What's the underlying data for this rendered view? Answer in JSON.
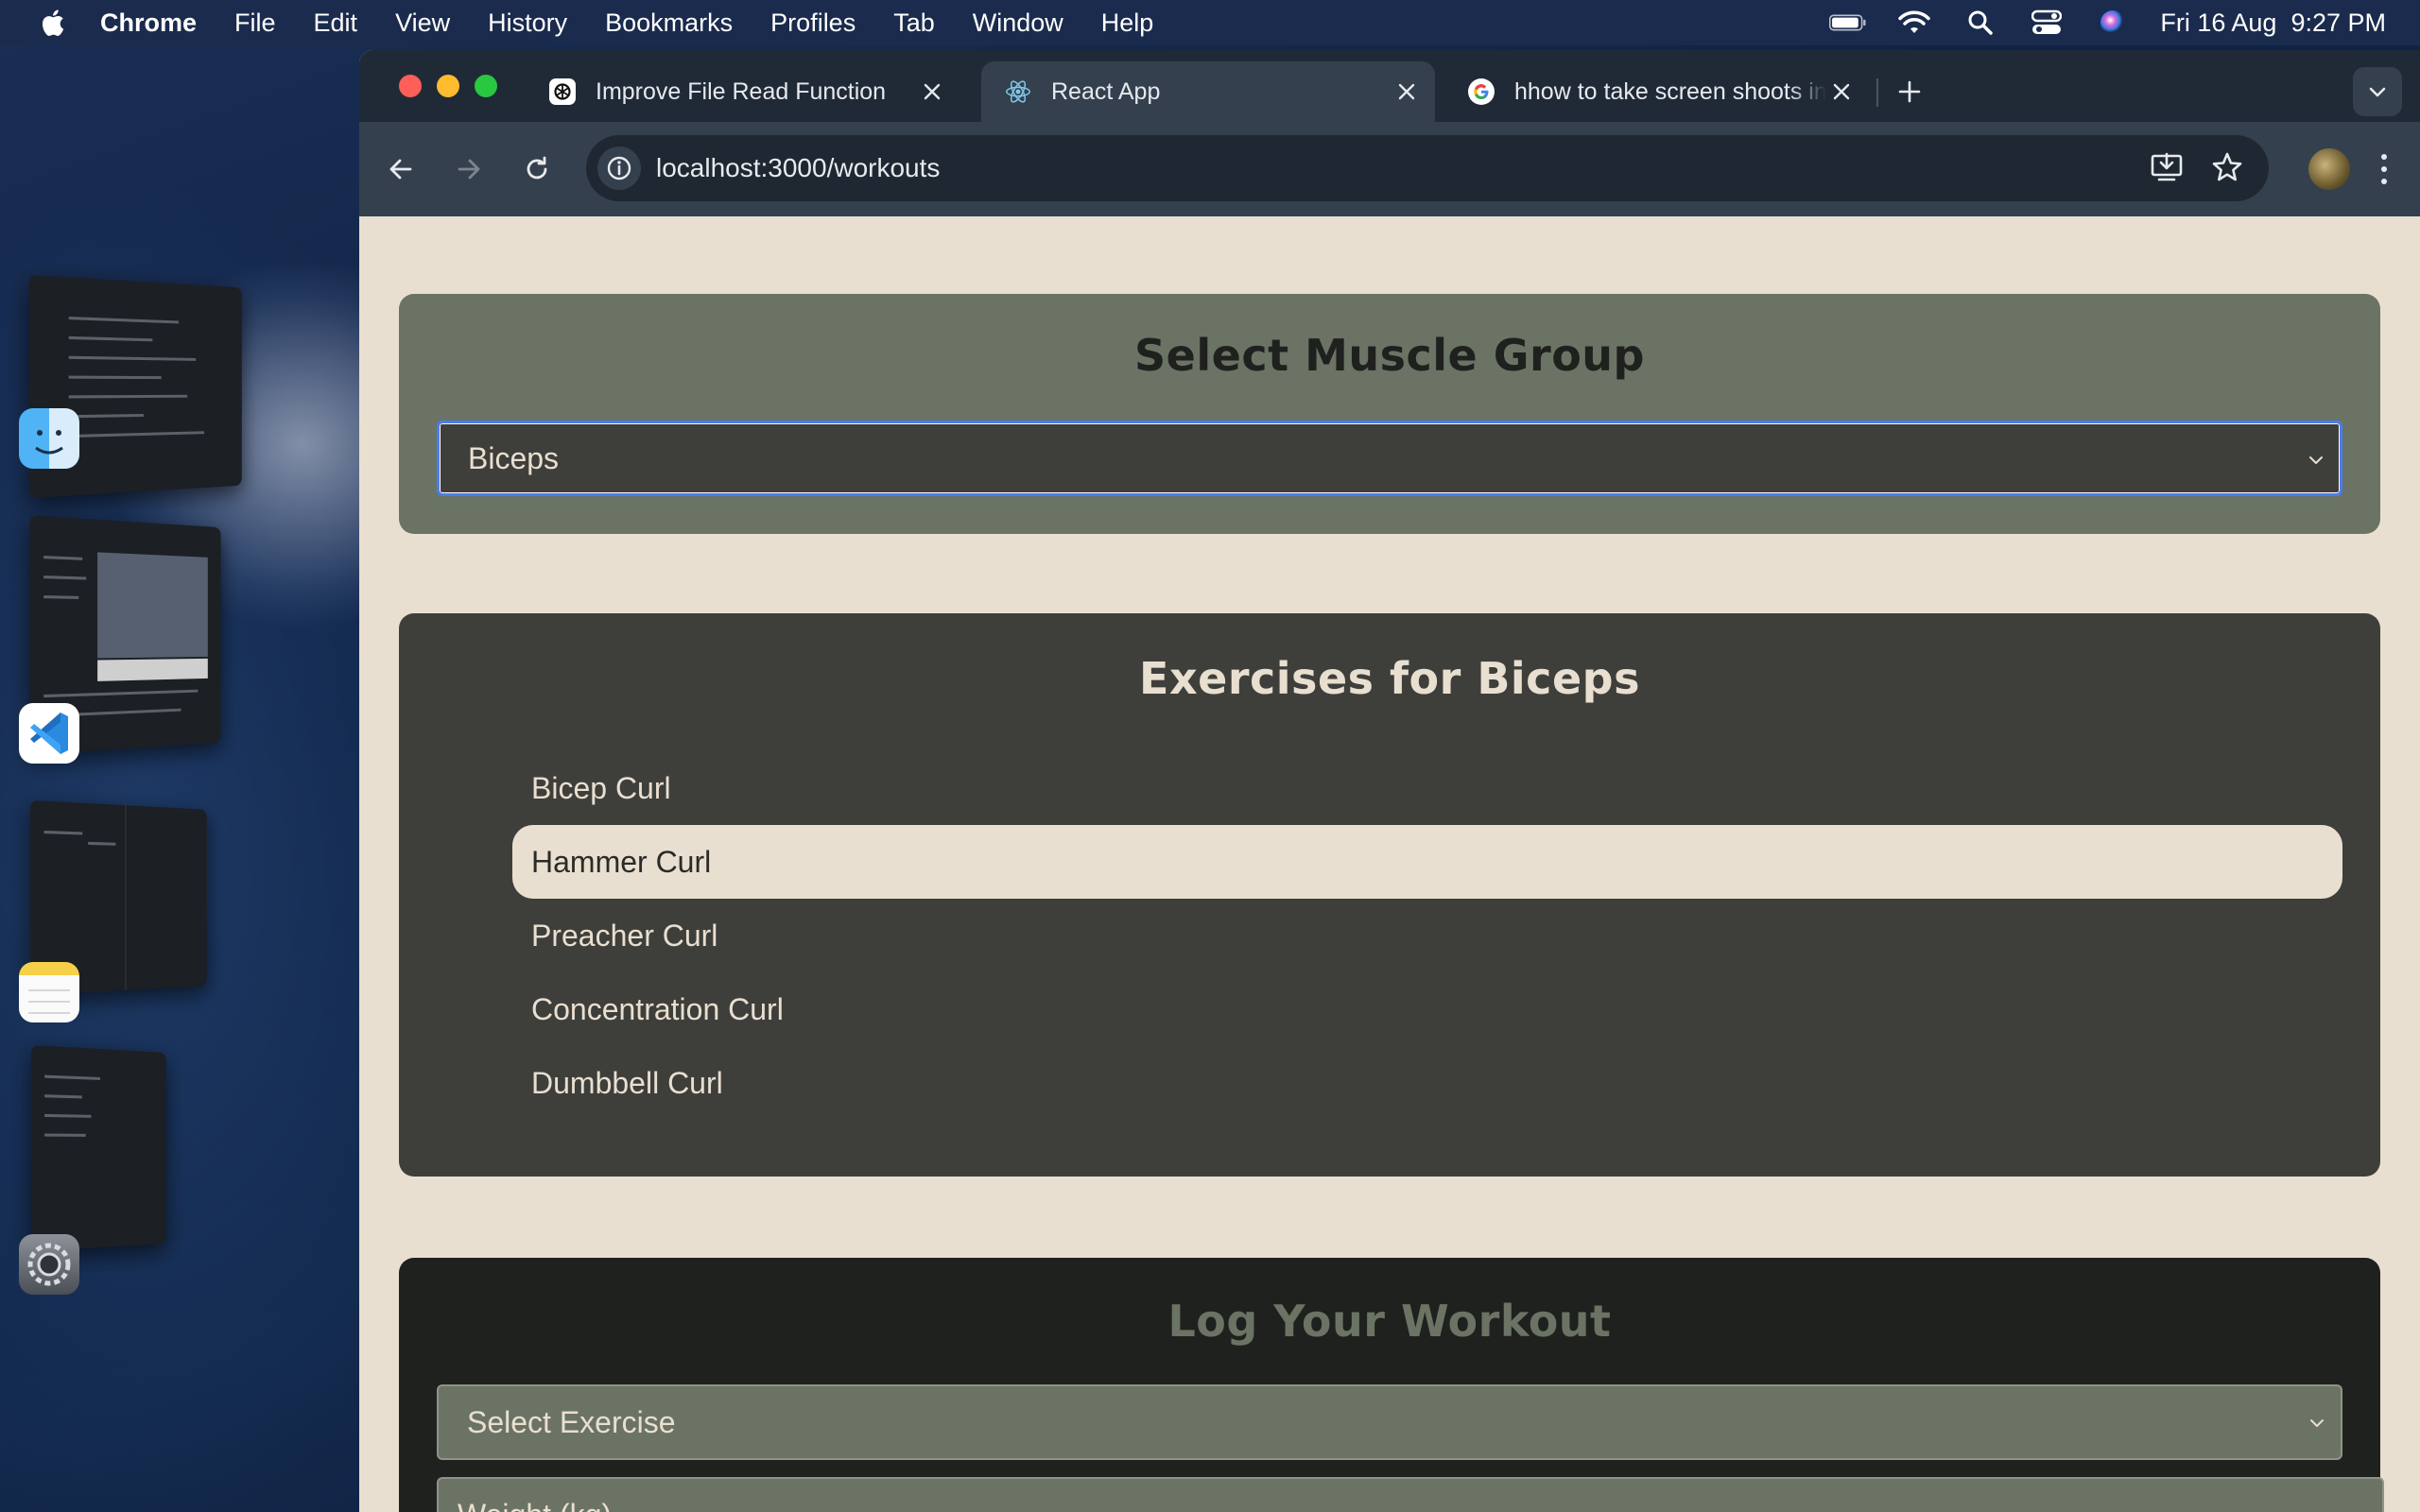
{
  "menubar": {
    "app": "Chrome",
    "items": [
      "File",
      "Edit",
      "View",
      "History",
      "Bookmarks",
      "Profiles",
      "Tab",
      "Window",
      "Help"
    ],
    "datetime": "Fri 16 Aug  9:27 PM"
  },
  "tabs": [
    {
      "title": "Improve File Read Function",
      "icon": "openai-icon"
    },
    {
      "title": "React App",
      "icon": "react-icon",
      "active": true
    },
    {
      "title": "hhow to take screen shoots in",
      "icon": "google-icon"
    }
  ],
  "address": {
    "url": "localhost:3000/workouts"
  },
  "muscle": {
    "title": "Select Muscle Group",
    "selected": "Biceps"
  },
  "exercises": {
    "title": "Exercises for Biceps",
    "items": [
      "Bicep Curl",
      "Hammer Curl",
      "Preacher Curl",
      "Concentration Curl",
      "Dumbbell Curl"
    ],
    "selected_index": 1
  },
  "log": {
    "title": "Log Your Workout",
    "exercise_placeholder": "Select Exercise",
    "weight_placeholder": "Weight (kg)"
  },
  "colors": {
    "page_bg": "#e9dfd0",
    "muscle_card": "#6b7364",
    "exercise_card": "#3e3f3b",
    "log_card": "#1e211e",
    "focus_ring": "#4a7cf0"
  }
}
